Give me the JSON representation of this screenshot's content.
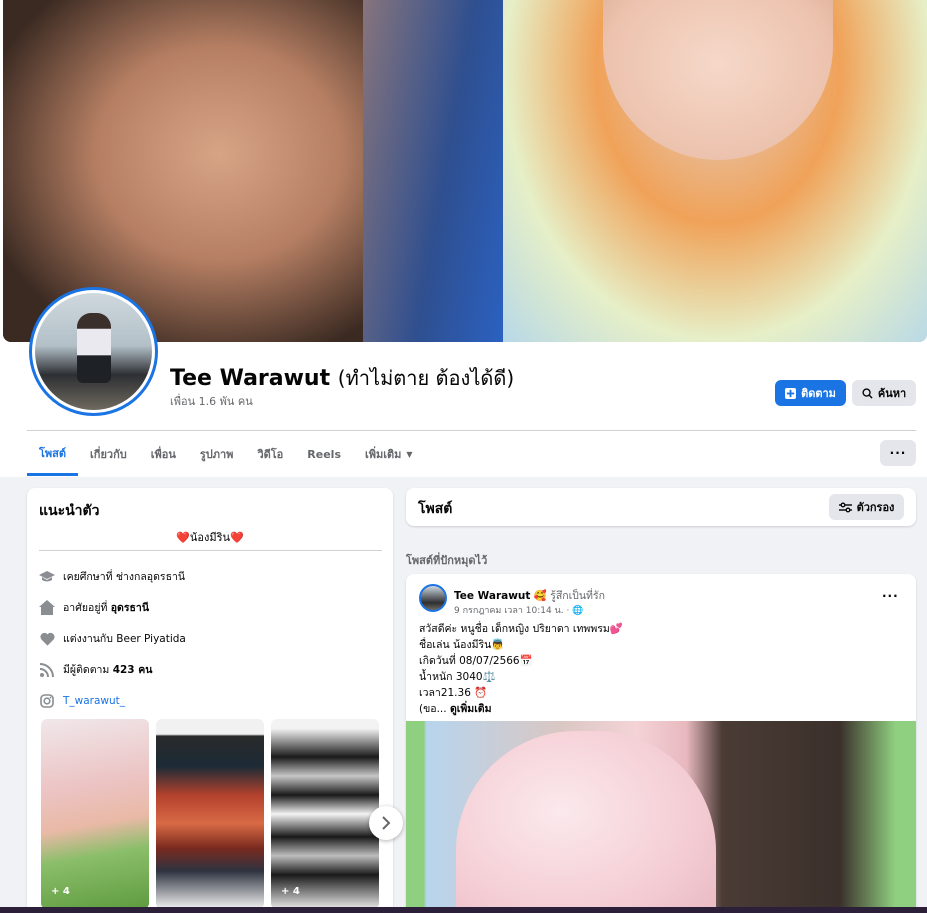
{
  "profile": {
    "name": "Tee Warawut",
    "nickname": "(ทำไม่ตาย ต้องได้ดี)",
    "friends": "เพื่อน 1.6 พัน คน"
  },
  "actions": {
    "follow_label": "ติดตาม",
    "search_label": "ค้นหา",
    "more_label": "···"
  },
  "tabs": [
    {
      "label": "โพสต์"
    },
    {
      "label": "เกี่ยวกับ"
    },
    {
      "label": "เพื่อน"
    },
    {
      "label": "รูปภาพ"
    },
    {
      "label": "วิดีโอ"
    },
    {
      "label": "Reels"
    },
    {
      "label": "เพิ่มเติม"
    }
  ],
  "intro": {
    "title": "แนะนำตัว",
    "bio": "❤️น้องมีริน❤️",
    "studied": "เคยศึกษาที่ ช่างกลอุดรธานี",
    "lives_prefix": "อาศัยอยู่ที่ ",
    "lives_place": "อุดรธานี",
    "married": "แต่งงานกับ Beer Piyatida",
    "followers_prefix": "มีผู้ติดตาม ",
    "followers_count": "423 คน",
    "instagram": "T_warawut_",
    "photo_counts": [
      "+ 4",
      "+ 4"
    ]
  },
  "posts_section": {
    "title": "โพสต์",
    "filter_label": "ตัวกรอง",
    "pinned_label": "โพสต์ที่ปักหมุดไว้"
  },
  "post": {
    "author": "Tee Warawut",
    "feeling": "รู้สึกเป็นที่รัก",
    "time": "9 กรกฎาคม เวลา 10:14 น. · ",
    "text": "สวัสดีค่ะ หนูชื่อ เด็กหญิง ปริยาดา เทพพรม💕\nชื่อเล่น น้องมีริน👼\nเกิดวันที่ 08/07/2566📅\nน้ำหนัก 3040⚖️\nเวลา21.36 ⏰\n(ขอ... ",
    "see_more": "ดูเพิ่มเติม",
    "more_label": "···"
  },
  "colors": {
    "accent": "#1b74e4",
    "background": "#f0f2f5",
    "card": "#ffffff",
    "secondary_text": "#65676b",
    "button_gray": "#e4e6eb"
  }
}
